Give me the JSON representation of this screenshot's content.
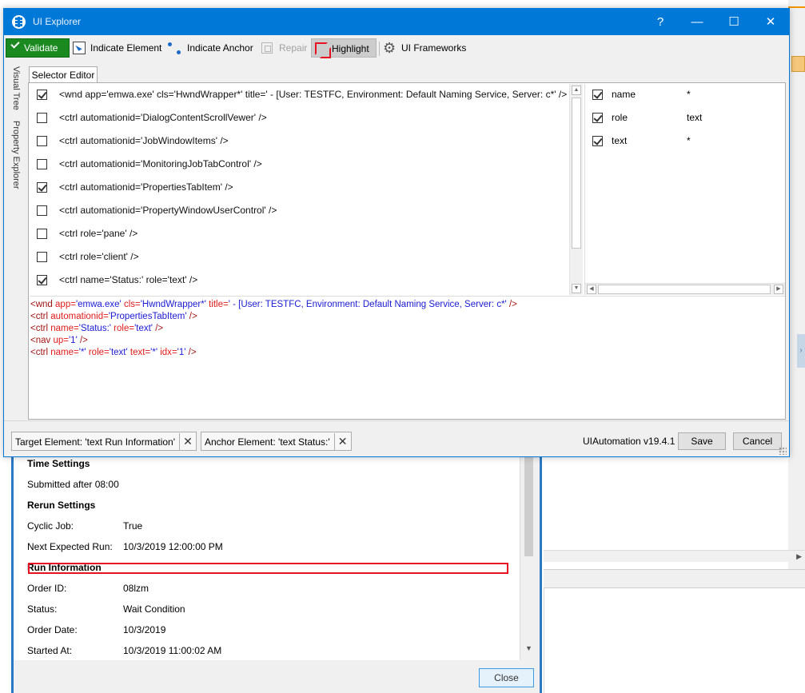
{
  "dialog": {
    "title": "UI Explorer",
    "titlebar_buttons": {
      "help": "?",
      "minimize": "—",
      "maximize": "☐",
      "close": "✕"
    }
  },
  "toolbar": {
    "validate": "Validate",
    "indicate_element": "Indicate Element",
    "indicate_anchor": "Indicate Anchor",
    "repair": "Repair",
    "highlight": "Highlight",
    "ui_frameworks": "UI Frameworks"
  },
  "side_tabs": {
    "visual_tree": "Visual Tree",
    "property_explorer": "Property Explorer"
  },
  "selector_editor": {
    "tab_label": "Selector Editor",
    "nodes": [
      {
        "checked": true,
        "text": "<wnd app='emwa.exe' cls='HwndWrapper*' title=' - [User: TESTFC, Environment: Default Naming Service, Server: c*' />"
      },
      {
        "checked": false,
        "text": "<ctrl automationid='DialogContentScrollVewer' />"
      },
      {
        "checked": false,
        "text": "<ctrl automationid='JobWindowItems' />"
      },
      {
        "checked": false,
        "text": "<ctrl automationid='MonitoringJobTabControl' />"
      },
      {
        "checked": true,
        "text": "<ctrl automationid='PropertiesTabItem' />"
      },
      {
        "checked": false,
        "text": "<ctrl automationid='PropertyWindowUserControl' />"
      },
      {
        "checked": false,
        "text": "<ctrl role='pane' />"
      },
      {
        "checked": false,
        "text": "<ctrl role='client' />"
      },
      {
        "checked": true,
        "text": "<ctrl name='Status:' role='text' />"
      }
    ],
    "attributes": [
      {
        "checked": true,
        "name": "name",
        "value": "*"
      },
      {
        "checked": true,
        "name": "role",
        "value": "text"
      },
      {
        "checked": true,
        "name": "text",
        "value": "*"
      }
    ],
    "xml_lines": [
      {
        "tag": "wnd",
        "attrs": [
          {
            "name": "app",
            "value": "'emwa.exe'"
          },
          {
            "name": "cls",
            "value": "'HwndWrapper*'"
          },
          {
            "name": "title",
            "value": "' - [User: TESTFC, Environment: Default Naming Service, Server: c*'"
          }
        ]
      },
      {
        "tag": "ctrl",
        "attrs": [
          {
            "name": "automationid",
            "value": "'PropertiesTabItem'"
          }
        ]
      },
      {
        "tag": "ctrl",
        "attrs": [
          {
            "name": "name",
            "value": "'Status:'"
          },
          {
            "name": "role",
            "value": "'text'"
          }
        ]
      },
      {
        "tag": "nav",
        "attrs": [
          {
            "name": "up",
            "value": "'1'"
          }
        ]
      },
      {
        "tag": "ctrl",
        "attrs": [
          {
            "name": "name",
            "value": "'*'"
          },
          {
            "name": "role",
            "value": "'text'"
          },
          {
            "name": "text",
            "value": "'*'"
          },
          {
            "name": "idx",
            "value": "'1'"
          }
        ]
      }
    ]
  },
  "footer": {
    "target_element": "Target Element: 'text  Run Information'",
    "anchor_element": "Anchor Element: 'text  Status:'",
    "remove_glyph": "✕",
    "version": "UIAutomation v19.4.1",
    "save": "Save",
    "cancel": "Cancel"
  },
  "job_window": {
    "rows": [
      {
        "label": "Time Settings",
        "bold": true
      },
      {
        "label": "Submitted after 08:00"
      },
      {
        "label": "Rerun Settings",
        "bold": true
      },
      {
        "label": "Cyclic Job:",
        "value": "True"
      },
      {
        "label": "Next Expected Run:",
        "value": "10/3/2019 12:00:00 PM"
      },
      {
        "label": "Run Information",
        "bold": true
      },
      {
        "label": "Order ID:",
        "value": "08lzm"
      },
      {
        "label": "Status:",
        "value": "Wait Condition"
      },
      {
        "label": "Order Date:",
        "value": "10/3/2019"
      },
      {
        "label": "Started At:",
        "value": "10/3/2019 11:00:02 AM"
      }
    ],
    "close": "Close"
  },
  "colors": {
    "titlebar": "#0078d7",
    "validate": "#1a8a20",
    "highlight_box": "#e81123",
    "xml_tag": "#a31515",
    "xml_attr": "#e21a1a",
    "xml_value": "#1a1ad6"
  }
}
